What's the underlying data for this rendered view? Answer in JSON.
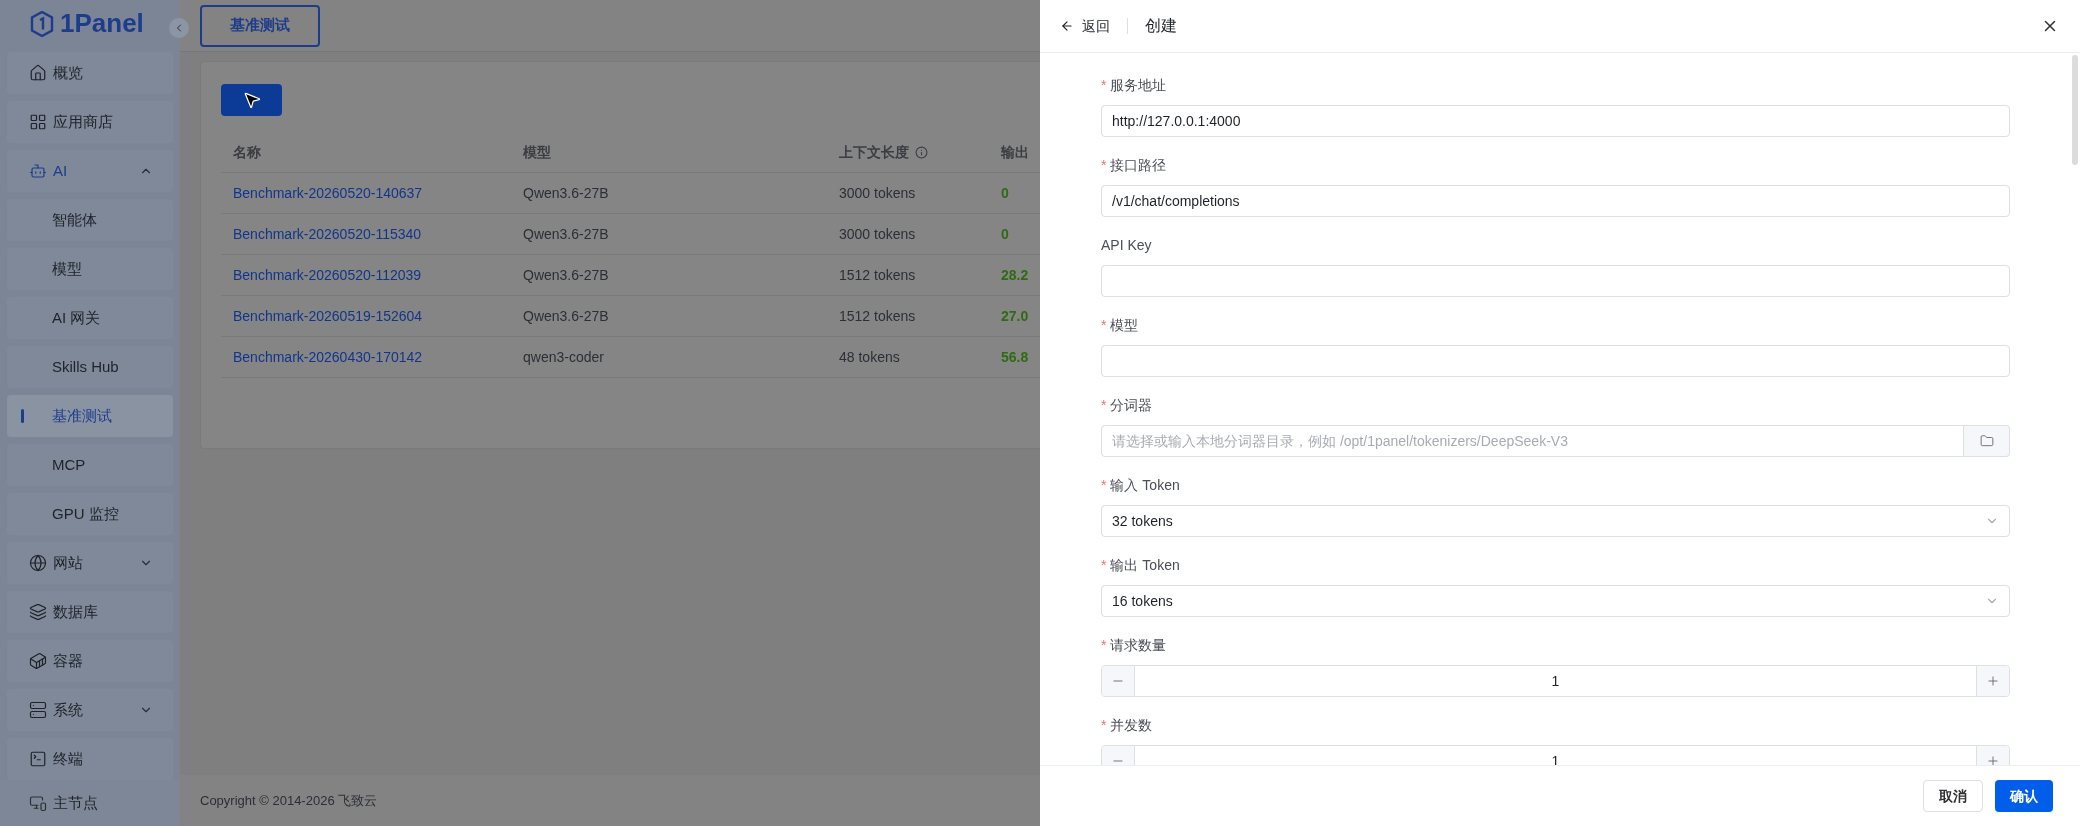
{
  "logo": {
    "text": "1Panel"
  },
  "sidebar": {
    "items": [
      {
        "label": "概览",
        "selected": false
      },
      {
        "label": "应用商店",
        "selected": false
      },
      {
        "label": "AI",
        "selected": false,
        "expanded": true,
        "children": [
          {
            "label": "智能体",
            "selected": false
          },
          {
            "label": "模型",
            "selected": false
          },
          {
            "label": "AI 网关",
            "selected": false
          },
          {
            "label": "Skills Hub",
            "selected": false
          },
          {
            "label": "基准测试",
            "selected": true
          },
          {
            "label": "MCP",
            "selected": false
          },
          {
            "label": "GPU 监控",
            "selected": false
          }
        ]
      },
      {
        "label": "网站",
        "selected": false,
        "expanded": false
      },
      {
        "label": "数据库",
        "selected": false
      },
      {
        "label": "容器",
        "selected": false
      },
      {
        "label": "系统",
        "selected": false,
        "expanded": false
      },
      {
        "label": "终端",
        "selected": false
      }
    ],
    "node": {
      "label": "主节点"
    }
  },
  "tabs": [
    {
      "label": "基准测试",
      "selected": true
    }
  ],
  "table": {
    "columns": [
      {
        "label": "名称"
      },
      {
        "label": "模型"
      },
      {
        "label": "上下文长度",
        "info": true
      },
      {
        "label": "输出"
      }
    ],
    "rows": [
      {
        "name": "Benchmark-20260520-140637",
        "model": "Qwen3.6-27B",
        "context": "3000 tokens",
        "output": "0"
      },
      {
        "name": "Benchmark-20260520-115340",
        "model": "Qwen3.6-27B",
        "context": "3000 tokens",
        "output": "0"
      },
      {
        "name": "Benchmark-20260520-112039",
        "model": "Qwen3.6-27B",
        "context": "1512 tokens",
        "output": "28.2"
      },
      {
        "name": "Benchmark-20260519-152604",
        "model": "Qwen3.6-27B",
        "context": "1512 tokens",
        "output": "27.0"
      },
      {
        "name": "Benchmark-20260430-170142",
        "model": "qwen3-coder",
        "context": "48 tokens",
        "output": "56.8"
      }
    ]
  },
  "footer": {
    "copyright": "Copyright © 2014-2026 飞致云"
  },
  "drawer": {
    "back": "返回",
    "title": "创建",
    "fields": [
      {
        "kind": "text",
        "label": "服务地址",
        "required_mark": "*",
        "value": "http://127.0.0.1:4000"
      },
      {
        "kind": "text",
        "label": "接口路径",
        "required_mark": "*",
        "value": "/v1/chat/completions"
      },
      {
        "kind": "text",
        "label": "API Key"
      },
      {
        "kind": "text",
        "label": "模型",
        "required_mark": "*"
      },
      {
        "kind": "folder",
        "label": "分词器",
        "required_mark": "*",
        "placeholder": "请选择或输入本地分词器目录，例如 /opt/1panel/tokenizers/DeepSeek-V3"
      },
      {
        "kind": "select",
        "label": "输入 Token",
        "required_mark": "*",
        "value": "32 tokens"
      },
      {
        "kind": "select",
        "label": "输出 Token",
        "required_mark": "*",
        "value": "16 tokens"
      },
      {
        "kind": "number",
        "label": "请求数量",
        "required_mark": "*",
        "value": "1"
      },
      {
        "kind": "number",
        "label": "并发数",
        "required_mark": "*",
        "value": "1"
      }
    ],
    "buttons": [
      {
        "label": "取消",
        "primary": false
      },
      {
        "label": "确认",
        "primary": true
      }
    ]
  }
}
